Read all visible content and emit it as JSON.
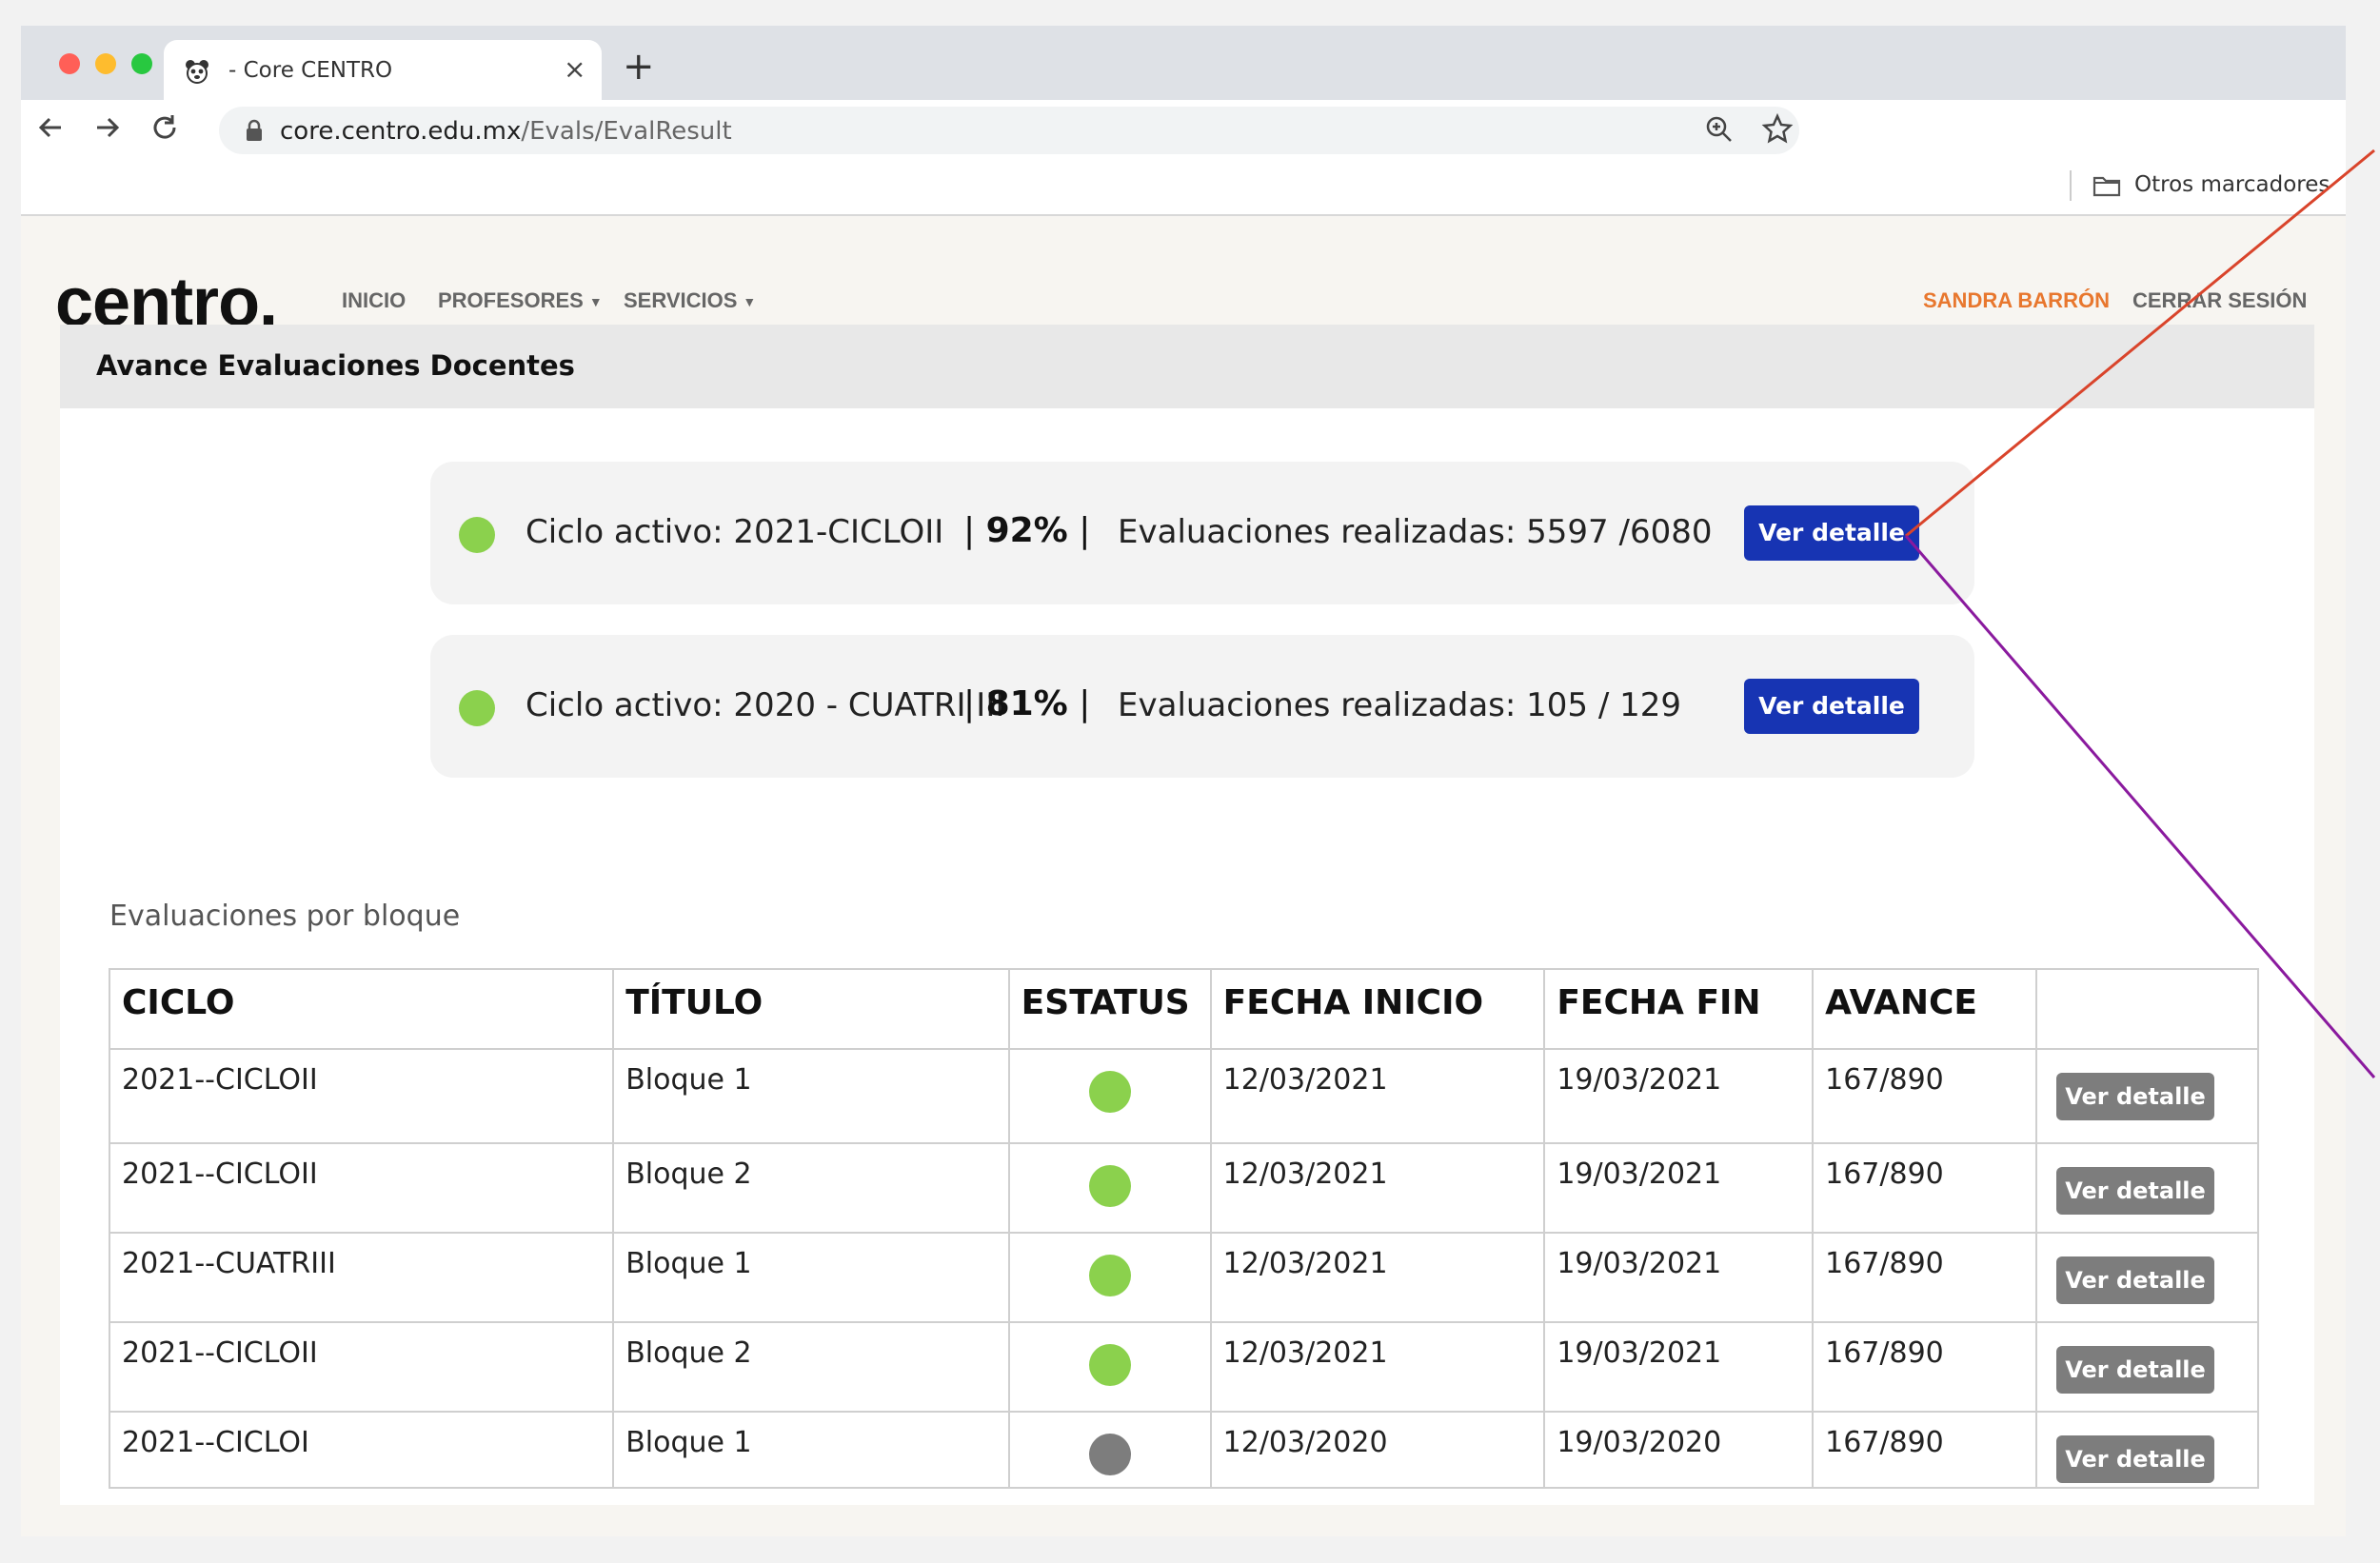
{
  "browser": {
    "tab_title": "- Core CENTRO",
    "tab_close": "×",
    "new_tab": "+",
    "url_host": "core.centro.edu.mx",
    "url_path": "/Evals/EvalResult",
    "bookmark_folder": "Otros marcadores"
  },
  "site": {
    "logo": "centro.",
    "nav": {
      "inicio": "INICIO",
      "profesores": "PROFESORES",
      "servicios": "SERVICIOS"
    },
    "user_name": "SANDRA BARRÓN",
    "logout": "CERRAR SESIÓN"
  },
  "panel": {
    "title": "Avance Evaluaciones Docentes",
    "cycles": [
      {
        "name": "Ciclo activo: 2021-CICLOII",
        "percent": "92%",
        "evaluations": "Evaluaciones realizadas: 5597 /6080",
        "button": "Ver detalle"
      },
      {
        "name": "Ciclo activo: 2020 - CUATRI III",
        "percent": "81%",
        "evaluations": "Evaluaciones realizadas: 105 / 129",
        "button": "Ver detalle"
      }
    ],
    "section_label": "Evaluaciones  por bloque",
    "table": {
      "headers": [
        "CICLO",
        "TÍTULO",
        "ESTATUS",
        "FECHA INICIO",
        "FECHA FIN",
        "AVANCE",
        ""
      ],
      "rows": [
        {
          "ciclo": "2021--CICLOII",
          "titulo": "Bloque 1",
          "status": "active",
          "inicio": "12/03/2021",
          "fin": "19/03/2021",
          "avance": "167/890",
          "button": "Ver detalle"
        },
        {
          "ciclo": "2021--CICLOII",
          "titulo": "Bloque 2",
          "status": "active",
          "inicio": "12/03/2021",
          "fin": "19/03/2021",
          "avance": "167/890",
          "button": "Ver detalle"
        },
        {
          "ciclo": "2021--CUATRIII",
          "titulo": "Bloque 1",
          "status": "active",
          "inicio": "12/03/2021",
          "fin": "19/03/2021",
          "avance": "167/890",
          "button": "Ver detalle"
        },
        {
          "ciclo": "2021--CICLOII",
          "titulo": "Bloque 2",
          "status": "active",
          "inicio": "12/03/2021",
          "fin": "19/03/2021",
          "avance": "167/890",
          "button": "Ver detalle"
        },
        {
          "ciclo": "2021--CICLOI",
          "titulo": "Bloque 1",
          "status": "inactive",
          "inicio": "12/03/2020",
          "fin": "19/03/2020",
          "avance": "167/890",
          "button": "Ver detalle"
        }
      ]
    }
  },
  "colors": {
    "status_active": "#8bd14d",
    "status_inactive": "#7d7d7d",
    "primary_button": "#1734b3",
    "secondary_button": "#7d7d7d",
    "user_accent": "#e8772e",
    "annotation_red": "#d9442b",
    "annotation_purple": "#8a1a9e"
  },
  "icons": [
    "tab-favicon-icon",
    "back-arrow-icon",
    "forward-arrow-icon",
    "reload-icon",
    "lock-icon",
    "zoom-icon",
    "star-icon",
    "folder-icon",
    "caret-down-icon"
  ]
}
